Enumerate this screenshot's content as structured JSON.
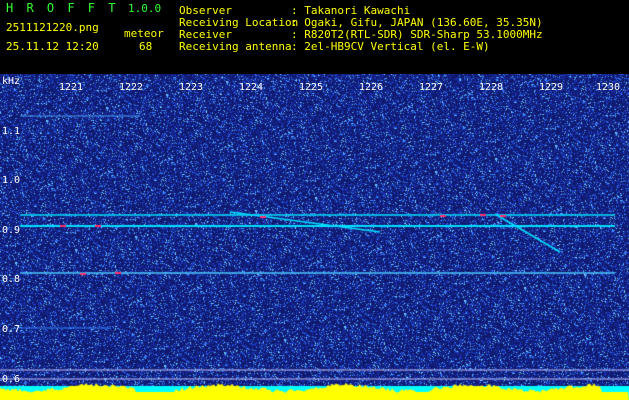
{
  "header": {
    "app_title": "H R O F F T",
    "version": "1.0.0",
    "filename": "2511121220.png",
    "datetime": "25.11.12 12:20",
    "meteor_label": "meteor",
    "meteor_count": "68",
    "fields": [
      {
        "key": "Observer",
        "value": ": Takanori Kawachi"
      },
      {
        "key": "Receiving Location",
        "value": ": Ogaki, Gifu, JAPAN (136.60E, 35.35N)"
      },
      {
        "key": "Receiver",
        "value": ": R820T2(RTL-SDR) SDR-Sharp 53.1000MHz"
      },
      {
        "key": "Receiving antenna",
        "value": ": 2el-HB9CV Vertical (el. E-W)"
      }
    ]
  },
  "spectrogram": {
    "unit": "kHz",
    "time_ticks": [
      "1221",
      "1222",
      "1223",
      "1224",
      "1225",
      "1226",
      "1227",
      "1228",
      "1229",
      "1230"
    ],
    "freq_ticks": [
      "1.1",
      "1.0",
      "0.9",
      "0.8",
      "0.7",
      "0.6"
    ],
    "colors": {
      "background": "#101a70",
      "noise": "#4aa0ff",
      "signal": "#00e0ff",
      "echo": "#ff3070",
      "bottom_bar": "#ffff00",
      "cyan_bar": "#00ffff"
    }
  }
}
